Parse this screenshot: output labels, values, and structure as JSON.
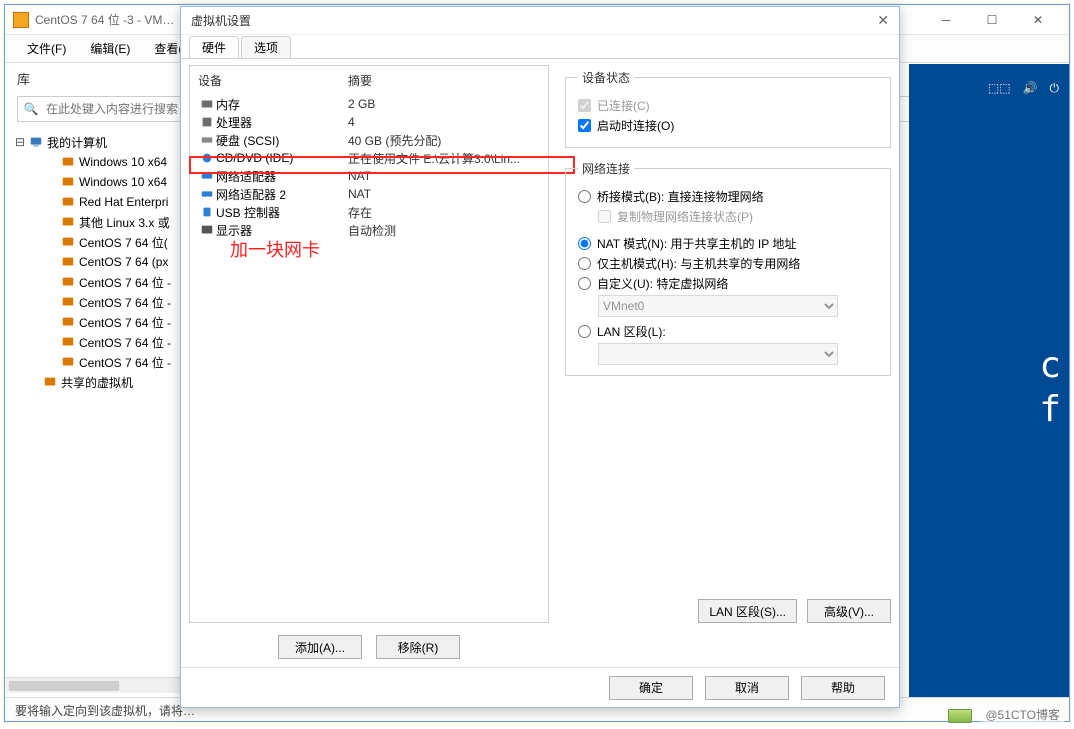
{
  "main_window": {
    "title": "CentOS 7 64 位 -3 - VM…",
    "menu": {
      "file": "文件(F)",
      "edit": "编辑(E)",
      "view": "查看(V)"
    },
    "library_label": "库",
    "search_placeholder": "在此处键入内容进行搜索",
    "tree_root": "我的计算机",
    "tree_items": [
      "Windows 10 x64",
      "Windows 10 x64",
      "Red Hat Enterpri",
      "其他 Linux 3.x 或",
      "CentOS 7 64 位(",
      "CentOS 7 64  (px",
      "CentOS 7 64 位 -",
      "CentOS 7 64 位 -",
      "CentOS 7 64 位 -",
      "CentOS 7 64 位 -",
      "CentOS 7 64 位 -"
    ],
    "tree_shared": "共享的虚拟机",
    "statusbar": "要将输入定向到该虚拟机，请将…",
    "strip_letters": "c\nf"
  },
  "dialog": {
    "title": "虚拟机设置",
    "tabs": {
      "hardware": "硬件",
      "options": "选项"
    },
    "hw_columns": {
      "device": "设备",
      "summary": "摘要"
    },
    "hw_rows": [
      {
        "name": "内存",
        "summary": "2 GB"
      },
      {
        "name": "处理器",
        "summary": "4"
      },
      {
        "name": "硬盘 (SCSI)",
        "summary": "40 GB (预先分配)"
      },
      {
        "name": "CD/DVD (IDE)",
        "summary": "正在使用文件 E:\\云计算3.0\\Lin..."
      },
      {
        "name": "网络适配器",
        "summary": "NAT"
      },
      {
        "name": "网络适配器 2",
        "summary": "NAT"
      },
      {
        "name": "USB 控制器",
        "summary": "存在"
      },
      {
        "name": "显示器",
        "summary": "自动检测"
      }
    ],
    "annotation": "加一块网卡",
    "add_btn": "添加(A)...",
    "remove_btn": "移除(R)",
    "device_status": {
      "legend": "设备状态",
      "connected": "已连接(C)",
      "connect_at_poweron": "启动时连接(O)"
    },
    "network": {
      "legend": "网络连接",
      "bridged": "桥接模式(B): 直接连接物理网络",
      "replicate": "复制物理网络连接状态(P)",
      "nat": "NAT 模式(N): 用于共享主机的 IP 地址",
      "hostonly": "仅主机模式(H): 与主机共享的专用网络",
      "custom": "自定义(U): 特定虚拟网络",
      "custom_value": "VMnet0",
      "lan_segment": "LAN 区段(L):",
      "lan_segment_value": "",
      "lan_btn": "LAN 区段(S)...",
      "adv_btn": "高级(V)..."
    },
    "footer": {
      "ok": "确定",
      "cancel": "取消",
      "help": "帮助"
    }
  },
  "watermark": "@51CTO博客"
}
